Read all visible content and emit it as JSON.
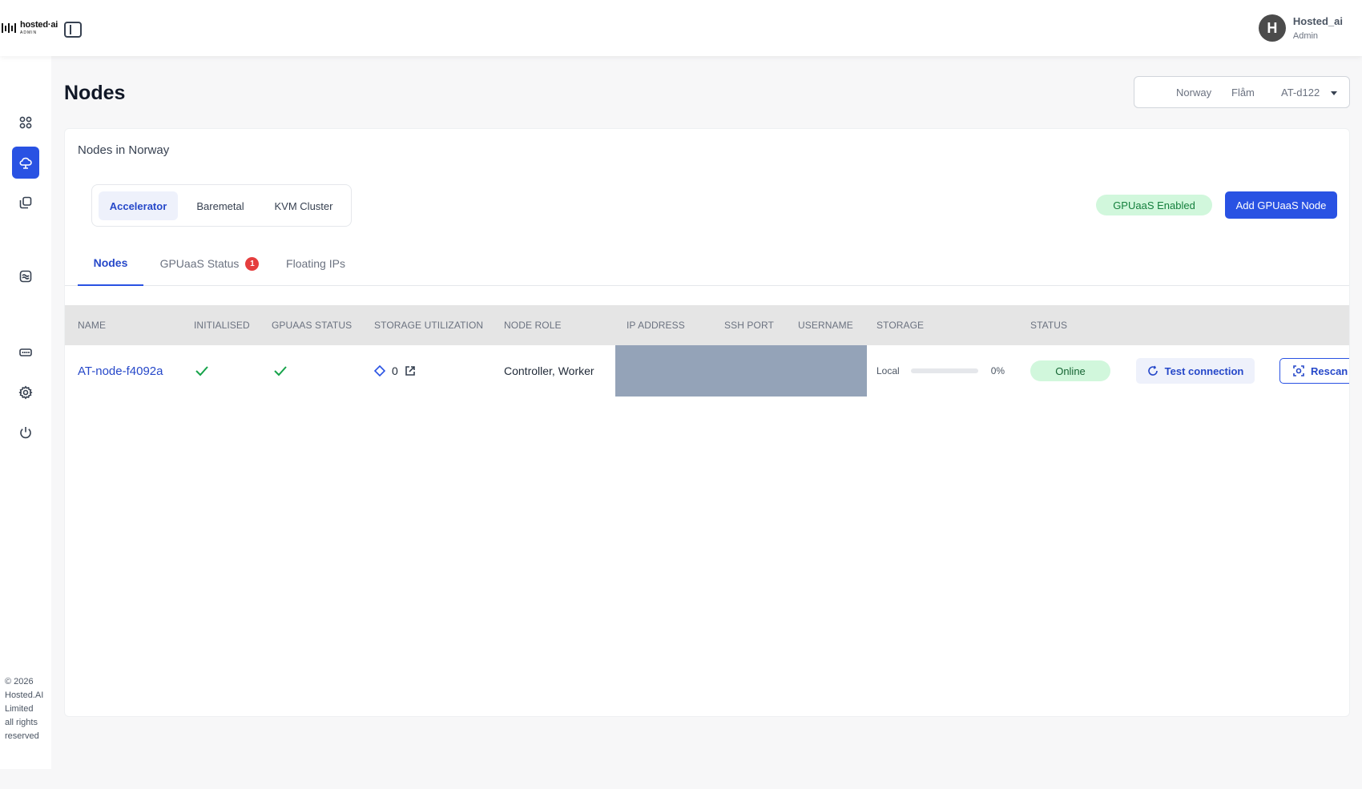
{
  "brand": {
    "name": "hosted·ai",
    "sub": "ADMIN"
  },
  "user": {
    "initial": "H",
    "name": "Hosted_ai",
    "role": "Admin"
  },
  "nav": [
    {
      "name": "nav-dashboard",
      "icon": "grid-icon"
    },
    {
      "name": "nav-cloud",
      "icon": "cloud-icon",
      "active": true
    },
    {
      "name": "nav-copy",
      "icon": "copy-icon"
    },
    {
      "name": "nav-analytics",
      "icon": "chart-icon"
    },
    {
      "name": "nav-hardware",
      "icon": "memory-icon"
    },
    {
      "name": "nav-settings",
      "icon": "gear-icon"
    },
    {
      "name": "nav-logout",
      "icon": "power-icon"
    }
  ],
  "footer": {
    "line1": "© 2026",
    "line2": "Hosted.AI",
    "line3": "Limited",
    "line4": "all rights",
    "line5": "reserved"
  },
  "page": {
    "title": "Nodes"
  },
  "region": {
    "country": "Norway",
    "city": "Flåm",
    "dc": "AT-d122"
  },
  "card": {
    "title": "Nodes in Norway"
  },
  "type_tabs": [
    "Accelerator",
    "Baremetal",
    "KVM Cluster"
  ],
  "gpuaas_badge": "GPUaaS Enabled",
  "add_button": "Add GPUaaS Node",
  "subtabs": {
    "nodes": "Nodes",
    "status": "GPUaaS Status",
    "status_count": "1",
    "floating": "Floating IPs"
  },
  "columns": {
    "name": "NAME",
    "initialised": "INITIALISED",
    "gpuaas_status": "GPUAAS STATUS",
    "storage_util": "STORAGE UTILIZATION",
    "role": "NODE ROLE",
    "ip": "IP ADDRESS",
    "ssh": "SSH PORT",
    "username": "USERNAME",
    "storage": "STORAGE",
    "status": "STATUS"
  },
  "row": {
    "name": "AT-node-f4092a",
    "storage_util_value": "0",
    "role": "Controller, Worker",
    "storage_type": "Local",
    "storage_percent": "0%",
    "storage_fraction": 0,
    "status": "Online",
    "test_button": "Test connection",
    "rescan_button": "Rescan r"
  }
}
